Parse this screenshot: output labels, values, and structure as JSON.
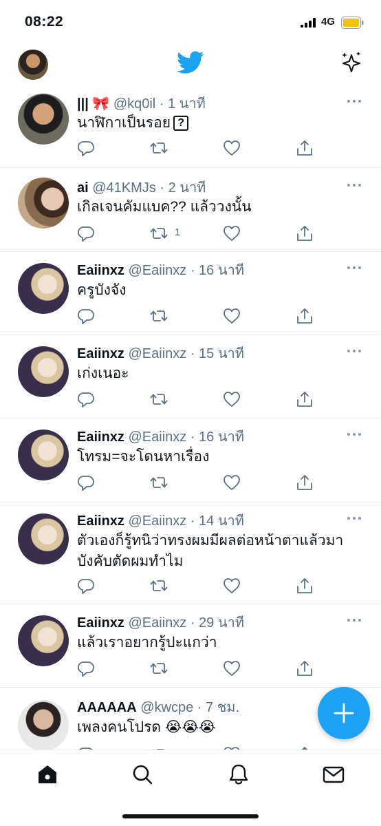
{
  "status_bar": {
    "time": "08:22",
    "network": "4G",
    "battery_color": "#f5c211"
  },
  "header": {
    "logo": "twitter-bird-icon",
    "brand_color": "#1da1f2",
    "right_icon": "sparkle-icon"
  },
  "tweets": [
    {
      "name": "||| 🎀",
      "handle": "@kq0il",
      "time": "1 นาที",
      "text": "นาฬิกาเป็นรอย",
      "text_box": "?",
      "retweets": ""
    },
    {
      "name": "ai",
      "handle": "@41KMJs",
      "time": "2 นาที",
      "text": "เกิลเจนคัมแบค?? แล้ววงนั้น",
      "retweets": "1"
    },
    {
      "name": "Eaiinxz",
      "handle": "@Eaiinxz",
      "time": "16 นาที",
      "text": "ครูบังจัง",
      "retweets": ""
    },
    {
      "name": "Eaiinxz",
      "handle": "@Eaiinxz",
      "time": "15 นาที",
      "text": "เก่งเนอะ",
      "retweets": ""
    },
    {
      "name": "Eaiinxz",
      "handle": "@Eaiinxz",
      "time": "16 นาที",
      "text": "โทรม=จะโดนหาเรื่อง",
      "retweets": ""
    },
    {
      "name": "Eaiinxz",
      "handle": "@Eaiinxz",
      "time": "14 นาที",
      "text": "ตัวเองก็รู้ทนิว่าทรงผมมีผลต่อหน้าตาแล้วมาบังคับตัดผมทำไม",
      "retweets": ""
    },
    {
      "name": "Eaiinxz",
      "handle": "@Eaiinxz",
      "time": "29 นาที",
      "text": "แล้วเราอยากรู้ปะแกว่า",
      "retweets": ""
    },
    {
      "name": "AAAAAA",
      "handle": "@kwcpe",
      "time": "7 ชม.",
      "text": "เพลงคนโปรด 😭😭😭",
      "retweets": ""
    }
  ],
  "fab": {
    "icon": "plus-icon"
  },
  "tab_bar": {
    "tabs": [
      "home-icon",
      "search-icon",
      "notifications-icon",
      "messages-icon"
    ],
    "active": "home-icon"
  }
}
